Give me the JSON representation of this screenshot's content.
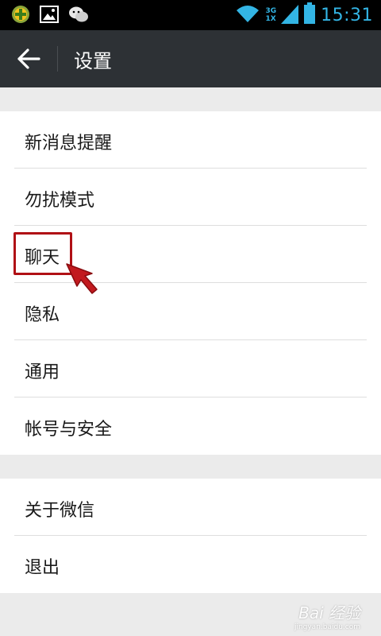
{
  "status_bar": {
    "time": "15:31",
    "network_top": "3G",
    "network_bottom": "1X",
    "icons": [
      "app-plus-icon",
      "gallery-icon",
      "wechat-icon",
      "wifi-icon",
      "signal-icon",
      "battery-icon"
    ],
    "accent_color": "#33b5e5"
  },
  "action_bar": {
    "back_icon": "arrow-left-icon",
    "title": "设置"
  },
  "settings": {
    "group1": [
      {
        "label": "新消息提醒"
      },
      {
        "label": "勿扰模式"
      },
      {
        "label": "聊天"
      },
      {
        "label": "隐私"
      },
      {
        "label": "通用"
      },
      {
        "label": "帐号与安全"
      }
    ],
    "group2": [
      {
        "label": "关于微信"
      },
      {
        "label": "退出"
      }
    ]
  },
  "annotation": {
    "highlighted_item": "聊天",
    "color": "#b01015"
  },
  "watermark": {
    "text": "Bai 经验",
    "url": "jingyan.baidu.com"
  }
}
